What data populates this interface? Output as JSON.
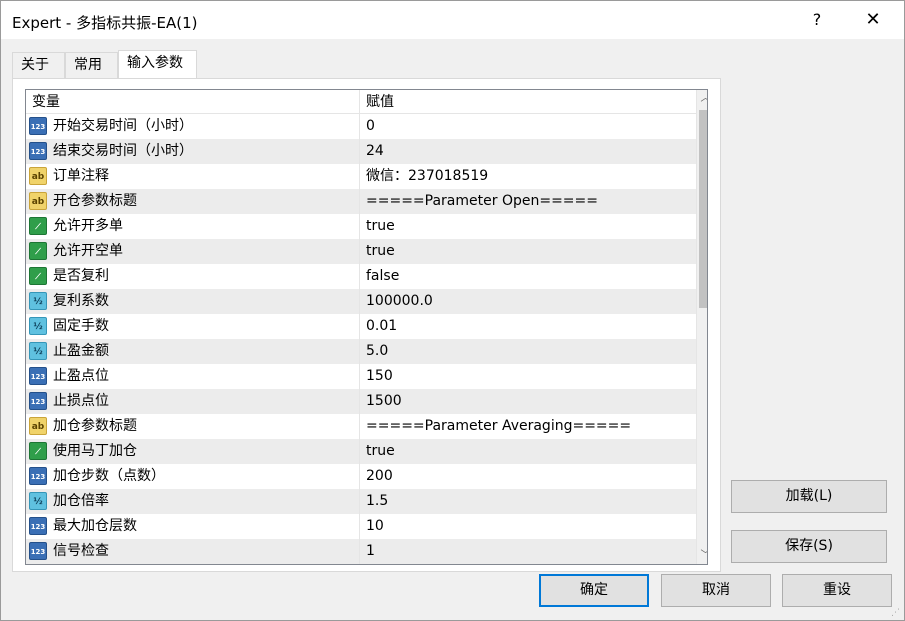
{
  "window": {
    "title": "Expert - 多指标共振-EA(1)",
    "help_glyph": "?",
    "close_glyph": "✕"
  },
  "tabs": [
    {
      "label": "关于"
    },
    {
      "label": "常用"
    },
    {
      "label": "输入参数"
    }
  ],
  "table": {
    "header": {
      "variable": "变量",
      "value": "赋值"
    },
    "rows": [
      {
        "type": "int",
        "name": "开始交易时间（小时）",
        "value": "0"
      },
      {
        "type": "int",
        "name": "结束交易时间（小时）",
        "value": "24"
      },
      {
        "type": "str",
        "name": "订单注释",
        "value": "微信：237018519"
      },
      {
        "type": "str",
        "name": "开仓参数标题",
        "value": "=====Parameter Open====="
      },
      {
        "type": "bool",
        "name": "允许开多单",
        "value": "true"
      },
      {
        "type": "bool",
        "name": "允许开空单",
        "value": "true"
      },
      {
        "type": "bool",
        "name": "是否复利",
        "value": "false"
      },
      {
        "type": "dbl",
        "name": "复利系数",
        "value": "100000.0"
      },
      {
        "type": "dbl",
        "name": "固定手数",
        "value": "0.01"
      },
      {
        "type": "dbl",
        "name": "止盈金额",
        "value": "5.0"
      },
      {
        "type": "int",
        "name": "止盈点位",
        "value": "150"
      },
      {
        "type": "int",
        "name": "止损点位",
        "value": "1500"
      },
      {
        "type": "str",
        "name": "加仓参数标题",
        "value": "=====Parameter Averaging====="
      },
      {
        "type": "bool",
        "name": "使用马丁加仓",
        "value": "true"
      },
      {
        "type": "int",
        "name": "加仓步数（点数）",
        "value": "200"
      },
      {
        "type": "dbl",
        "name": "加仓倍率",
        "value": "1.5"
      },
      {
        "type": "int",
        "name": "最大加仓层数",
        "value": "10"
      },
      {
        "type": "int",
        "name": "信号检查",
        "value": "1"
      }
    ],
    "icon_glyphs": {
      "int": "123",
      "str": "ab",
      "bool": "⟋",
      "dbl": "½"
    },
    "icon_names": {
      "int": "integer-type-icon",
      "str": "string-type-icon",
      "bool": "boolean-type-icon",
      "dbl": "double-type-icon"
    }
  },
  "buttons": {
    "load": "加载(L)",
    "save": "保存(S)",
    "ok": "确定",
    "cancel": "取消",
    "reset": "重设"
  },
  "colors": {
    "accent": "#0078d7",
    "row_alt": "#ececec"
  }
}
